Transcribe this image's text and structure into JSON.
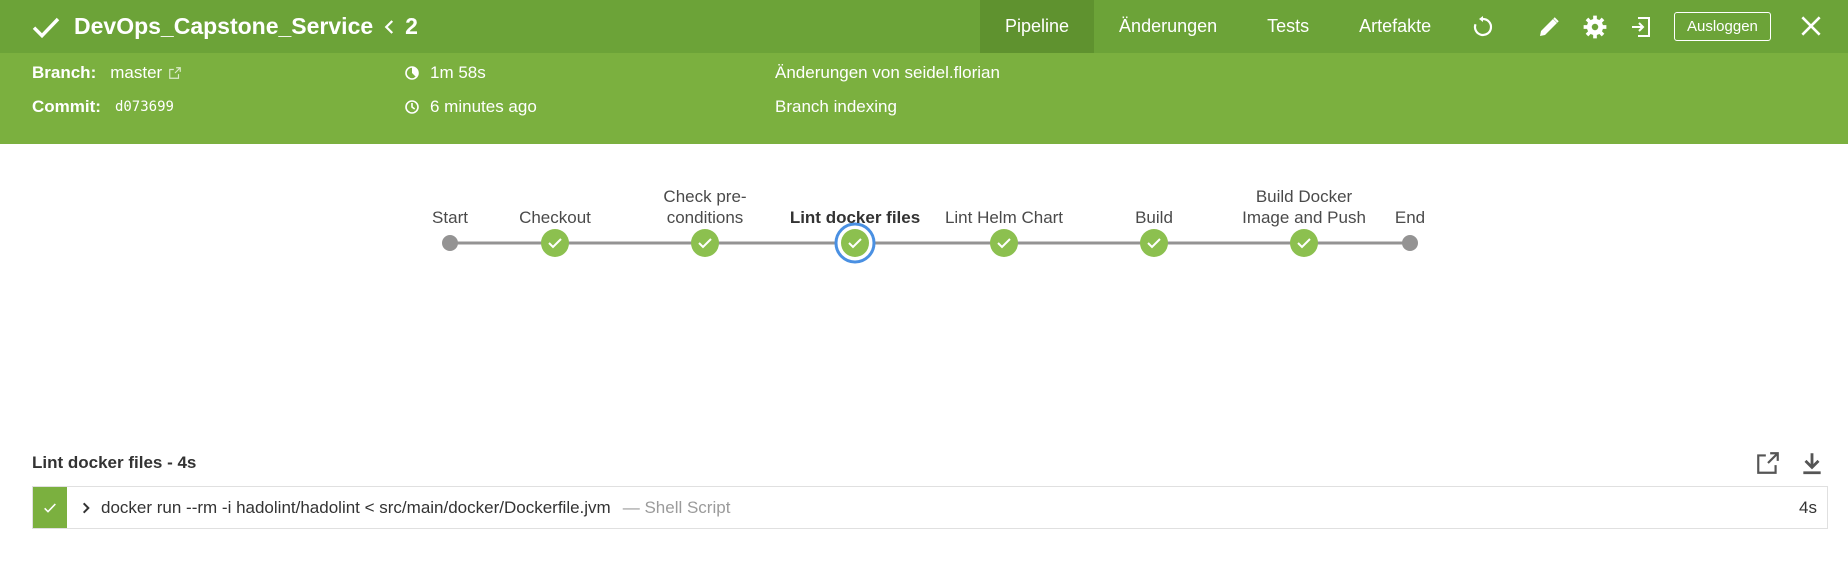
{
  "header": {
    "title": "DevOps_Capstone_Service",
    "run_number": "2",
    "tabs": [
      {
        "label": "Pipeline",
        "active": true
      },
      {
        "label": "Änderungen",
        "active": false
      },
      {
        "label": "Tests",
        "active": false
      },
      {
        "label": "Artefakte",
        "active": false
      }
    ],
    "logout_label": "Ausloggen",
    "colors": {
      "primary": "#6ca338",
      "info": "#7bb03f",
      "active_tab": "#5f922f"
    }
  },
  "info": {
    "branch_label": "Branch:",
    "branch_value": "master",
    "commit_label": "Commit:",
    "commit_value": "d073699",
    "duration": "1m 58s",
    "time_ago": "6 minutes ago",
    "changes": "Änderungen von seidel.florian",
    "cause": "Branch indexing"
  },
  "pipeline": {
    "stages": [
      {
        "label": "Start",
        "status": "start"
      },
      {
        "label": "Checkout",
        "status": "success"
      },
      {
        "label": "Check pre-conditions",
        "label_lines": [
          "Check pre-",
          "conditions"
        ],
        "status": "success"
      },
      {
        "label": "Lint docker files",
        "status": "success",
        "selected": true
      },
      {
        "label": "Lint Helm Chart",
        "status": "success"
      },
      {
        "label": "Build",
        "status": "success"
      },
      {
        "label": "Build Docker Image and Push",
        "label_lines": [
          "Build Docker",
          "Image and Push"
        ],
        "status": "success"
      },
      {
        "label": "End",
        "status": "end"
      }
    ],
    "colors": {
      "success": "#8cc04f",
      "node": "#949393",
      "selected_ring": "#4a90e2"
    }
  },
  "log": {
    "title": "Lint docker files - 4s",
    "steps": [
      {
        "command": "docker run --rm -i hadolint/hadolint < src/main/docker/Dockerfile.jvm",
        "type": "— Shell Script",
        "duration": "4s",
        "status": "success"
      }
    ]
  }
}
